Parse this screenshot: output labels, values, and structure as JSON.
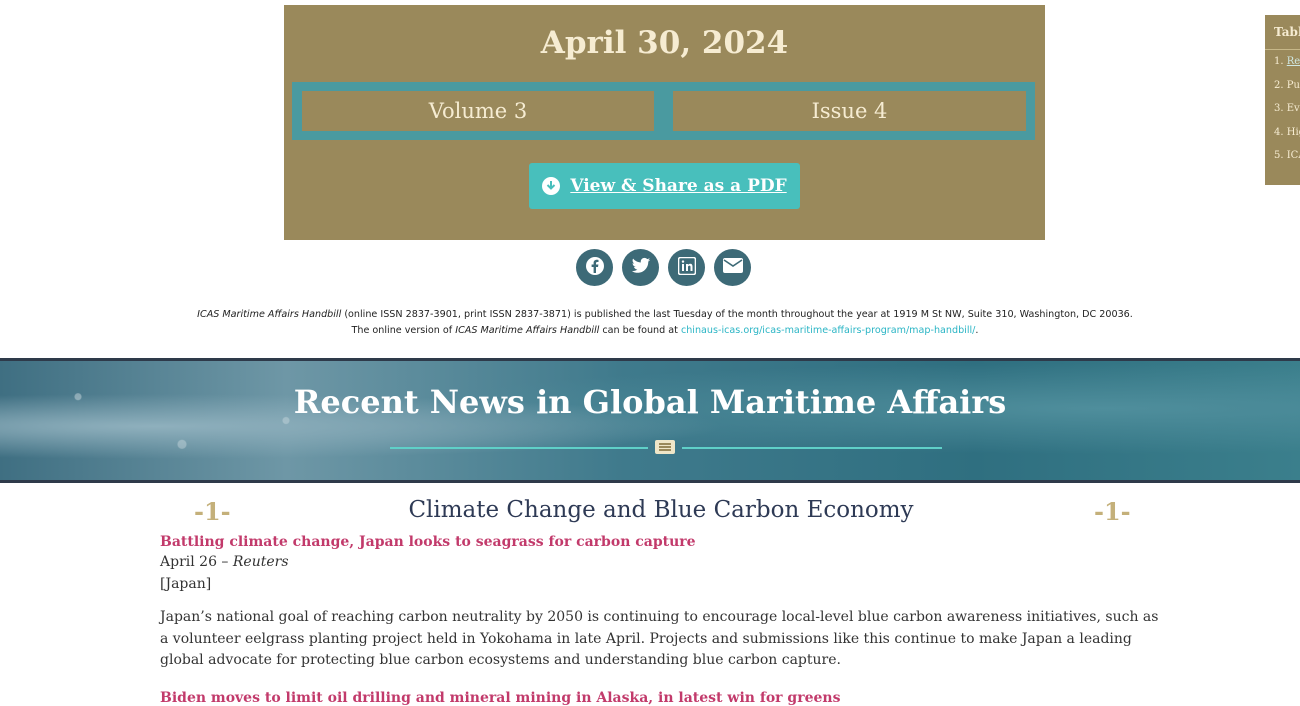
{
  "header": {
    "date": "April 30, 2024",
    "volume": "Volume 3",
    "issue": "Issue 4",
    "pdf_button": "View & Share as a PDF"
  },
  "share_icons": [
    "facebook-icon",
    "twitter-icon",
    "linkedin-icon",
    "email-icon"
  ],
  "publication": {
    "line1_title": "ICAS Maritime Affairs Handbill",
    "line1_rest": " (online ISSN 2837-3901, print ISSN 2837-3871) is published the last Tuesday of the month throughout the year at 1919 M St NW, Suite 310, Washington, DC 20036.",
    "line2_pre": "The online version of ",
    "line2_title": "ICAS Maritime Affairs Handbill",
    "line2_mid": " can be found at ",
    "line2_link": "chinaus-icas.org/icas-maritime-affairs-program/map-handbill/",
    "line2_end": "."
  },
  "toc": {
    "title": "Table of Contents",
    "items": [
      {
        "num": "1.",
        "label": "Recent News"
      },
      {
        "num": "2.",
        "label": "Publications"
      },
      {
        "num": "3.",
        "label": "Events"
      },
      {
        "num": "4.",
        "label": "Highlights"
      },
      {
        "num": "5.",
        "label": "ICAS"
      }
    ]
  },
  "banner": {
    "title": "Recent News in Global Maritime Affairs"
  },
  "section": {
    "number": "-1-",
    "title": "Climate Change and Blue Carbon Economy"
  },
  "articles": [
    {
      "headline": "Battling climate change, Japan looks to seagrass for carbon capture",
      "date": "April 26 –",
      "source": "Reuters",
      "region": "[Japan]",
      "body": "Japan’s national goal of reaching carbon neutrality by 2050 is continuing to encourage local-level blue carbon awareness initiatives, such as a volunteer eelgrass planting project held in Yokohama in late April. Projects and submissions like this continue to make Japan a leading global advocate for protecting blue carbon ecosystems and understanding blue carbon capture."
    },
    {
      "headline": "Biden moves to limit oil drilling and mineral mining in Alaska, in latest win for greens"
    }
  ],
  "colors": {
    "hero_bg": "#9a895b",
    "accent_teal": "#48bfbc",
    "share_bg": "#3d6a77",
    "headline_link": "#c23a6b",
    "section_title": "#2e3a55"
  }
}
